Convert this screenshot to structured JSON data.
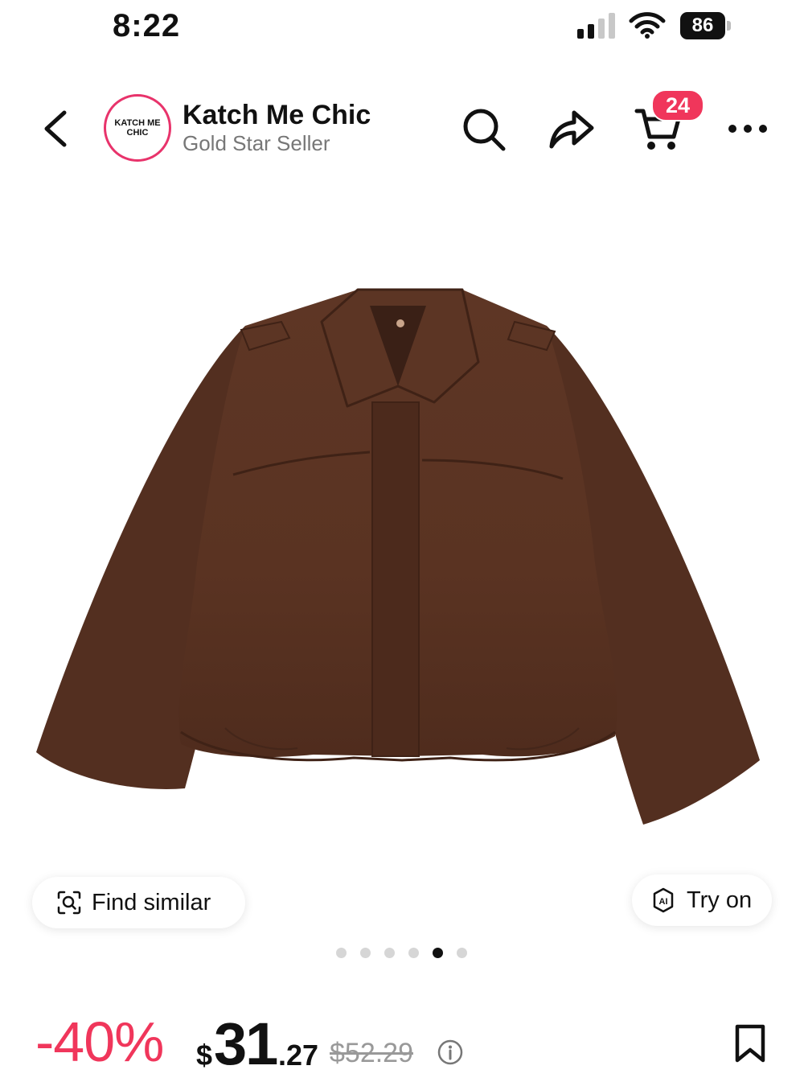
{
  "status_bar": {
    "time": "8:22",
    "battery": "86"
  },
  "header": {
    "store_logo_text": "KATCH ME CHIC",
    "store_name": "Katch Me Chic",
    "store_subtitle": "Gold Star Seller",
    "cart_count": "24"
  },
  "gallery": {
    "find_similar_label": "Find similar",
    "try_on_label": "Try on",
    "total_images": 6,
    "active_image_index": 4
  },
  "price": {
    "discount": "-40%",
    "currency": "$",
    "main": "31",
    "cents": ".27",
    "original": "$52.29"
  },
  "colors": {
    "accent": "#f0365b",
    "avatar_ring": "#e8336b",
    "product_brown": "#5a3322"
  }
}
